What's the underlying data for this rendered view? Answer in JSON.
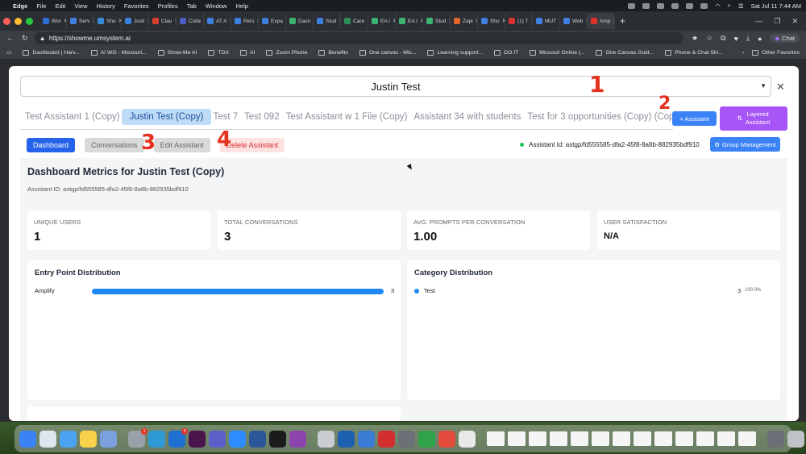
{
  "menubar": {
    "app": "Edge",
    "items": [
      "File",
      "Edit",
      "View",
      "History",
      "Favorites",
      "Profiles",
      "Tab",
      "Window",
      "Help"
    ],
    "datetime": "Sat Jul 11  7:44 AM"
  },
  "browser_tabs": [
    {
      "label": "Wor",
      "color": "#2f6fd6"
    },
    {
      "label": "Serv",
      "color": "#3f7fe0"
    },
    {
      "label": "Sho",
      "color": "#3a8bd8"
    },
    {
      "label": "Justi",
      "color": "#3f7fe0"
    },
    {
      "label": "Clau",
      "color": "#d9412f"
    },
    {
      "label": "Colla",
      "color": "#4b5cc4"
    },
    {
      "label": "AT A",
      "color": "#3f7fe0"
    },
    {
      "label": "Pers",
      "color": "#3f7fe0"
    },
    {
      "label": "Expa",
      "color": "#3f7fe0"
    },
    {
      "label": "Dash",
      "color": "#3cb371"
    },
    {
      "label": "Stud",
      "color": "#3f7fe0"
    },
    {
      "label": "Care",
      "color": "#2e8b57"
    },
    {
      "label": "EA I",
      "color": "#3cb371"
    },
    {
      "label": "EA I",
      "color": "#3cb371"
    },
    {
      "label": "Stud",
      "color": "#3cb371"
    },
    {
      "label": "Zapi",
      "color": "#e0642f"
    },
    {
      "label": "Sho",
      "color": "#3f7fe0"
    },
    {
      "label": "(1) T",
      "color": "#d93030"
    },
    {
      "label": "MUT",
      "color": "#3f7fe0"
    },
    {
      "label": "Web",
      "color": "#3f7fe0"
    },
    {
      "label": "Amp",
      "color": "#e0342b"
    }
  ],
  "address": {
    "url": "https://showme.umsystem.ai",
    "chat_label": "Chat"
  },
  "favorites": [
    "Dashboard | Harv...",
    "AI WG - Missouri...",
    "Show-Me AI",
    "TDX",
    "AI",
    "Zoom Phone",
    "Benefits",
    "One canvas - Mis...",
    "Learning support...",
    "DO IT",
    "Missouri Online |...",
    "One Canvas Guid...",
    "Phone & Chat Shi..."
  ],
  "favorites_other": "Other Favorites",
  "modal": {
    "selected_assistant": "Justin Test",
    "tabs": [
      {
        "label": "Test Assistant 1 (Copy)",
        "active": false
      },
      {
        "label": "Justin Test (Copy)",
        "active": true
      },
      {
        "label": "Test 7",
        "active": false
      },
      {
        "label": "Test 092",
        "active": false
      },
      {
        "label": "Test Assistant w 1 File (Copy)",
        "active": false
      },
      {
        "label": "Assistant 34 with students",
        "active": false
      },
      {
        "label": "Test for 3 opportunities (Copy) (Copy)",
        "active": false
      }
    ],
    "add_assistant": "+ Assistant",
    "layered_assistant_line1": "Layered",
    "layered_assistant_line2": "Assistant",
    "actions": {
      "dashboard": "Dashboard",
      "conversations": "Conversations",
      "edit": "Edit Assistant",
      "delete": "Delete Assistant"
    },
    "assistant_id_label": "Assistant Id: astgp/fd555585-dfa2-45f8-8a8b-882935bdf910",
    "group_management": "Group Management"
  },
  "dashboard": {
    "title": "Dashboard Metrics for Justin Test (Copy)",
    "assistant_id": "Assistant ID: astgp/fd555585-dfa2-45f8-8a8b-882935bdf910",
    "metrics": [
      {
        "label": "UNIQUE USERS",
        "value": "1"
      },
      {
        "label": "TOTAL CONVERSATIONS",
        "value": "3"
      },
      {
        "label": "AVG. PROMPTS PER CONVERSATION",
        "value": "1.00"
      },
      {
        "label": "USER SATISFACTION",
        "value": "N/A"
      }
    ],
    "entry_point": {
      "title": "Entry Point Distribution",
      "rows": [
        {
          "name": "Amplify",
          "count": "3",
          "fraction": 1.0
        }
      ]
    },
    "category": {
      "title": "Category Distribution",
      "rows": [
        {
          "name": "Test",
          "count": "3",
          "percent": "100.0%"
        }
      ]
    }
  },
  "annotations": [
    "1",
    "2",
    "3",
    "4"
  ],
  "colors": {
    "primary": "#2563eb",
    "layered": "#a855f7",
    "delete_text": "#d93030",
    "annotation": "#e5321e",
    "bar": "#1e88f5"
  }
}
